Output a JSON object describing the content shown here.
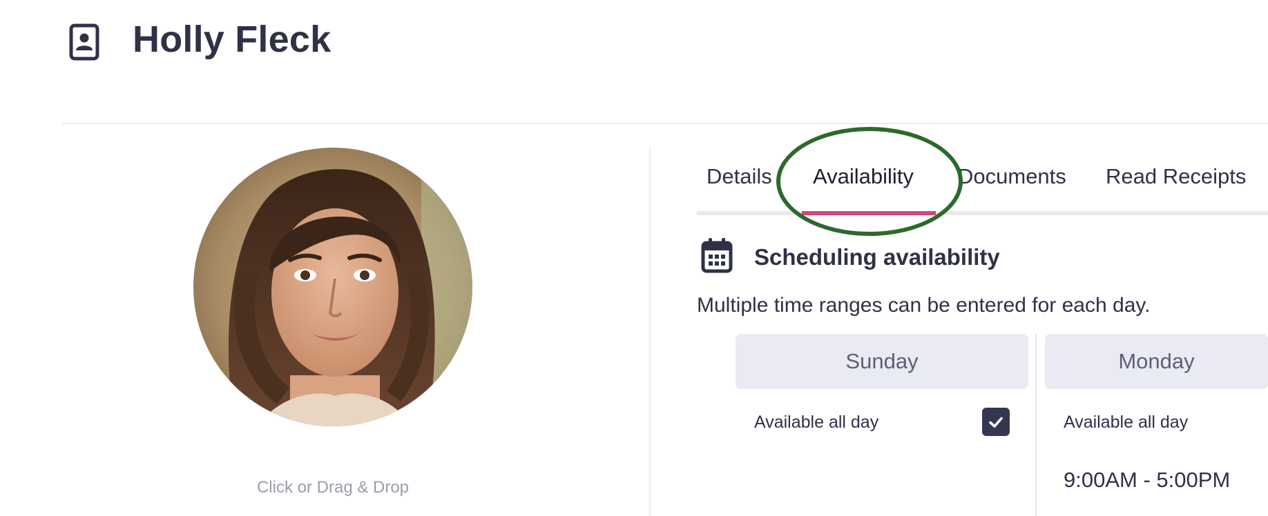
{
  "header": {
    "title": "Holly Fleck",
    "icon": "contact-card-icon"
  },
  "profile": {
    "upload_hint": "Click or Drag & Drop"
  },
  "tabs": [
    {
      "label": "Details",
      "active": false
    },
    {
      "label": "Availability",
      "active": true
    },
    {
      "label": "Documents",
      "active": false
    },
    {
      "label": "Read Receipts",
      "active": false
    }
  ],
  "availability": {
    "title": "Scheduling availability",
    "icon": "calendar-icon",
    "description": "Multiple time ranges can be entered for each day.",
    "days": [
      {
        "name": "Sunday",
        "all_day_label": "Available all day",
        "all_day_checked": true
      },
      {
        "name": "Monday",
        "all_day_label": "Available all day",
        "all_day_checked": false,
        "time_range": "9:00AM - 5:00PM"
      }
    ]
  },
  "colors": {
    "text": "#2f3147",
    "tab_active_underline": "#d6437e",
    "annotation_ellipse": "#2b6a2c",
    "day_header_bg": "#e9eaf2",
    "checkbox_bg": "#34374f"
  }
}
